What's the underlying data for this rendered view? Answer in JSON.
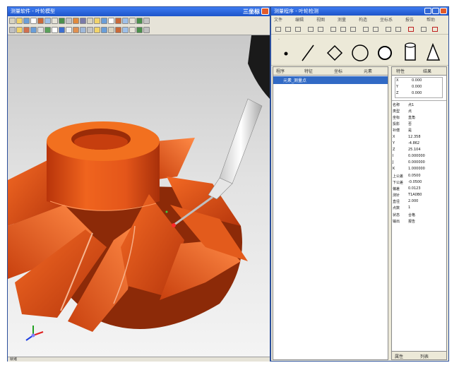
{
  "cad_window": {
    "title": "测量软件 - 叶轮模型",
    "title_right": "三坐标",
    "toolbar_groups": 2,
    "status_text": "就绪"
  },
  "measure_window": {
    "title": "测量程序 - 叶轮检测",
    "menu": [
      "文件",
      "编辑",
      "视图",
      "测量",
      "构造",
      "坐标系",
      "报告",
      "帮助"
    ],
    "feature_icons": [
      "point-icon",
      "line-icon",
      "plane-icon",
      "circle-icon",
      "sphere-icon",
      "cylinder-icon",
      "cone-icon"
    ],
    "left_tabs": [
      "程序",
      "特征",
      "坐标",
      "元素"
    ],
    "tree_item": "元素_测量点",
    "right_tabs": [
      "特性",
      "结果"
    ],
    "top_values": [
      {
        "label": "X",
        "value": "0.000"
      },
      {
        "label": "Y",
        "value": "0.000"
      },
      {
        "label": "Z",
        "value": "0.000"
      }
    ],
    "value_rows": [
      {
        "label": "名称",
        "value": "点1"
      },
      {
        "label": "类型",
        "value": "点"
      },
      {
        "label": "坐标",
        "value": "直角"
      },
      {
        "label": "投影",
        "value": "否"
      },
      {
        "label": "补偿",
        "value": "是"
      },
      {
        "label": "X",
        "value": "12.358"
      },
      {
        "label": "Y",
        "value": "-4.862"
      },
      {
        "label": "Z",
        "value": "25.104"
      },
      {
        "label": "I",
        "value": "0.000000"
      },
      {
        "label": "J",
        "value": "0.000000"
      },
      {
        "label": "K",
        "value": "1.000000"
      },
      {
        "label": "上公差",
        "value": "0.0500"
      },
      {
        "label": "下公差",
        "value": "-0.0500"
      },
      {
        "label": "偏差",
        "value": "0.0123"
      },
      {
        "label": "测针",
        "value": "T1A0B0"
      },
      {
        "label": "直径",
        "value": "2.000"
      },
      {
        "label": "点数",
        "value": "1"
      },
      {
        "label": "状态",
        "value": "合格"
      },
      {
        "label": "输出",
        "value": "报告"
      }
    ],
    "bottom_tabs": [
      "属性",
      "列表"
    ]
  }
}
